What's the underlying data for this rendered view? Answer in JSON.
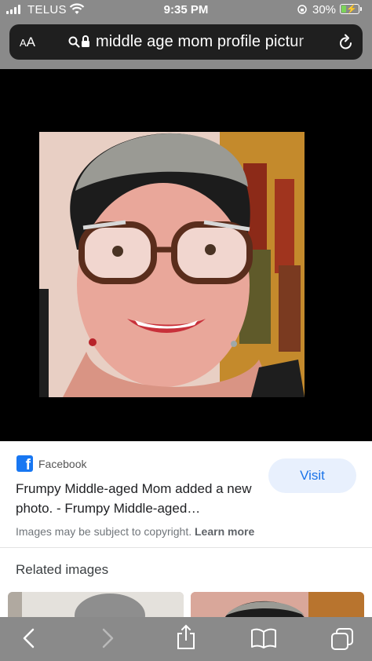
{
  "status_bar": {
    "carrier": "TELUS",
    "time": "9:35 PM",
    "battery_percent": "30%",
    "battery_level": 0.3,
    "icons": [
      "signal-icon",
      "wifi-icon",
      "orientation-lock-icon",
      "battery-charging-icon"
    ]
  },
  "address_bar": {
    "text_size_label": "AA",
    "url": "middle age mom profile pictur",
    "icons": [
      "search-icon",
      "lock-icon",
      "reload-icon"
    ]
  },
  "viewer": {
    "image_description_name": "photo"
  },
  "result_card": {
    "source": "Facebook",
    "title": "Frumpy Middle-aged Mom added a new photo. - Frumpy Middle-aged…",
    "visit_label": "Visit",
    "copyright_notice": "Images may be subject to copyright.",
    "learn_more_label": "Learn more"
  },
  "related": {
    "heading": "Related images"
  },
  "toolbar": {
    "icons": [
      "back-icon",
      "forward-icon",
      "share-icon",
      "bookmarks-icon",
      "tabs-icon"
    ]
  },
  "colors": {
    "chrome_gray": "#8a8a8a",
    "url_bar_bg": "#1f1f1f",
    "visit_button_bg": "#e8f0fd",
    "visit_button_text": "#1a73e8",
    "facebook_blue": "#1877f2",
    "battery_fill": "#7cd35a"
  }
}
